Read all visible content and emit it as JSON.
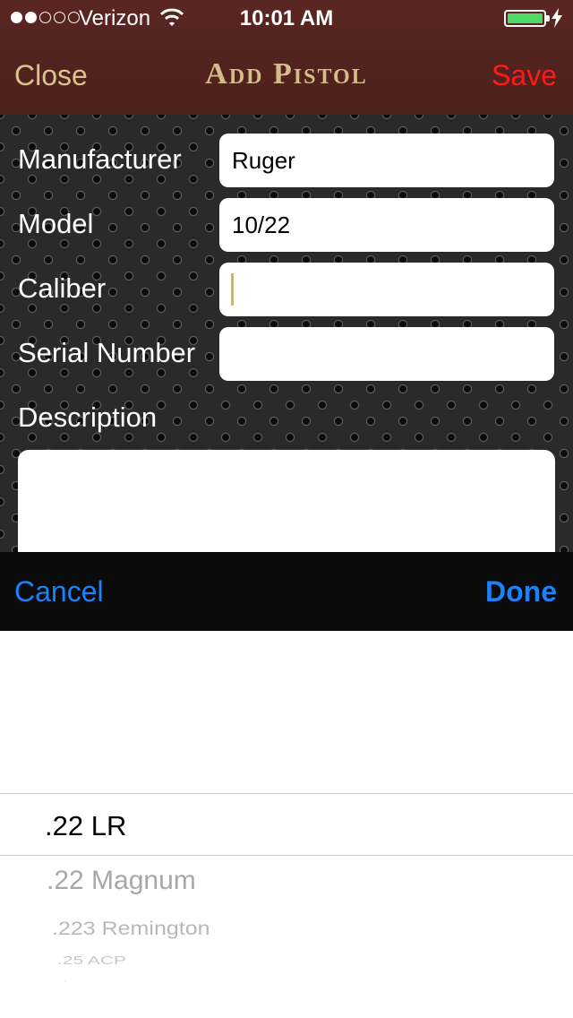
{
  "status_bar": {
    "carrier": "Verizon",
    "time": "10:01 AM",
    "signal_bars_filled": 2,
    "signal_bars_total": 5,
    "battery_level": 1.0,
    "battery_color": "#4cd964"
  },
  "nav": {
    "close_label": "Close",
    "title": "Add Pistol",
    "save_label": "Save",
    "close_color": "#d9c38f",
    "save_color": "#ff1a1a"
  },
  "form": {
    "fields": [
      {
        "label": "Manufacturer",
        "value": "Ruger"
      },
      {
        "label": "Model",
        "value": "10/22"
      },
      {
        "label": "Caliber",
        "value": ""
      },
      {
        "label": "Serial Number",
        "value": ""
      }
    ],
    "description_label": "Description",
    "description_value": ""
  },
  "toolbar": {
    "cancel_label": "Cancel",
    "done_label": "Done",
    "button_color": "#1a82fb"
  },
  "picker": {
    "selected": ".22 LR",
    "options": [
      ".22 LR",
      ".22 Magnum",
      ".223 Remington",
      ".25 ACP"
    ]
  }
}
